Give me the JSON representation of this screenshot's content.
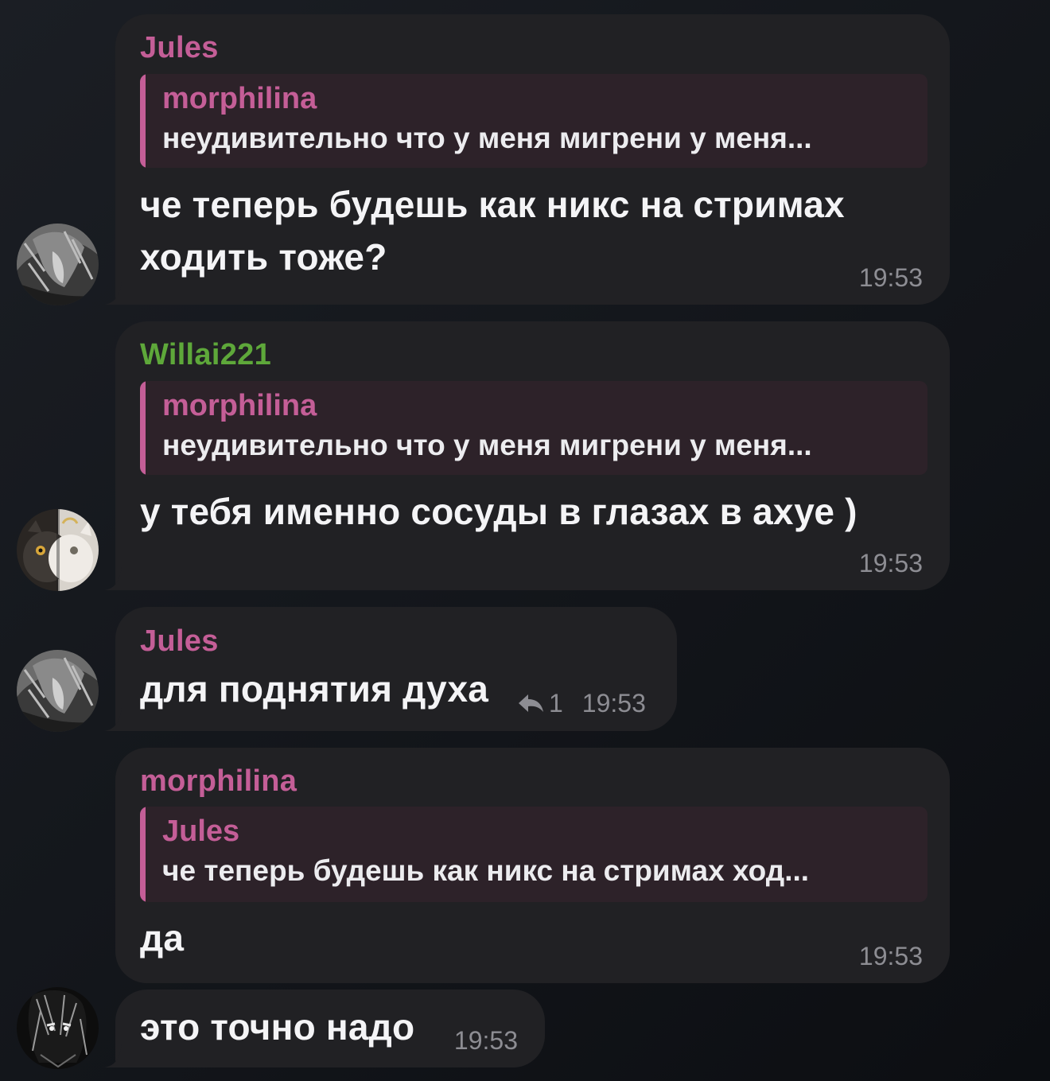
{
  "messages": [
    {
      "sender": "Jules",
      "reply_to": {
        "name": "morphilina",
        "text": "неудивительно что у меня мигрени у меня..."
      },
      "lines": [
        "че теперь будешь как никс на стримах",
        "ходить тоже?"
      ],
      "time": "19:53"
    },
    {
      "sender": "Willai221",
      "reply_to": {
        "name": "morphilina",
        "text": "неудивительно что у меня мигрени у меня..."
      },
      "lines": [
        "у тебя именно сосуды в глазах в ахуе )"
      ],
      "time": "19:53"
    },
    {
      "sender": "Jules",
      "lines": [
        "для поднятия духа"
      ],
      "reply_count": "1",
      "time": "19:53"
    },
    {
      "sender": "morphilina",
      "reply_to": {
        "name": "Jules",
        "text": "че теперь будешь как никс на стримах ход..."
      },
      "lines": [
        "да"
      ],
      "time": "19:53"
    },
    {
      "lines": [
        "это точно надо"
      ],
      "time": "19:53"
    }
  ],
  "colors": {
    "pink": "#c45e97",
    "green": "#5ea83a",
    "bubble": "#212124",
    "reply_bg": "#2d2229"
  },
  "icons": {
    "reply_count": "reply-arrow-icon"
  }
}
